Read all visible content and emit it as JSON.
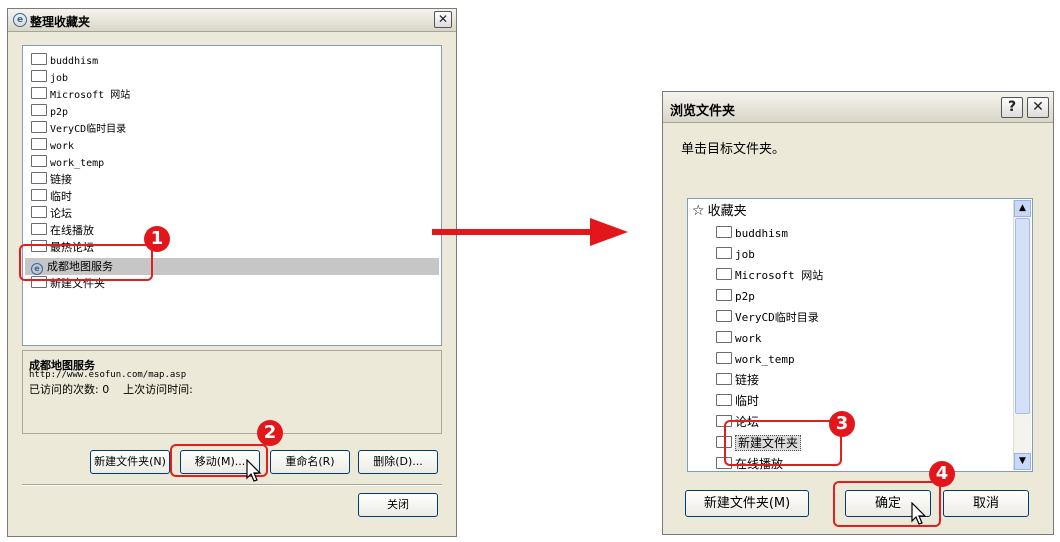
{
  "left_dialog": {
    "title": "整理收藏夹",
    "items": [
      "buddhism",
      "job",
      "Microsoft 网站",
      "p2p",
      "VeryCD临时目录",
      "work",
      "work_temp",
      "链接",
      "临时",
      "论坛",
      "在线播放",
      "最热论坛",
      "成都地图服务",
      "新建文件夹"
    ],
    "selected_index": 12,
    "info": {
      "name": "成都地图服务",
      "url": "http://www.esofun.com/map.asp",
      "visits": "已访问的次数: 0    上次访问时间:"
    },
    "buttons": {
      "new_folder": "新建文件夹(N)",
      "move": "移动(M)...",
      "rename": "重命名(R)",
      "delete": "删除(D)...",
      "close": "关闭"
    }
  },
  "right_dialog": {
    "title": "浏览文件夹",
    "instruction": "单击目标文件夹。",
    "root": "收藏夹",
    "items": [
      "buddhism",
      "job",
      "Microsoft 网站",
      "p2p",
      "VeryCD临时目录",
      "work",
      "work_temp",
      "链接",
      "临时",
      "论坛",
      "新建文件夹",
      "在线播放"
    ],
    "buttons": {
      "new_folder": "新建文件夹(M)",
      "ok": "确定",
      "cancel": "取消"
    }
  },
  "callouts": [
    "1",
    "2",
    "3",
    "4"
  ],
  "colors": {
    "callout_red": "#e3161b",
    "selection_gray": "#c6c6c6",
    "dialog_bg": "#ece9d8"
  }
}
